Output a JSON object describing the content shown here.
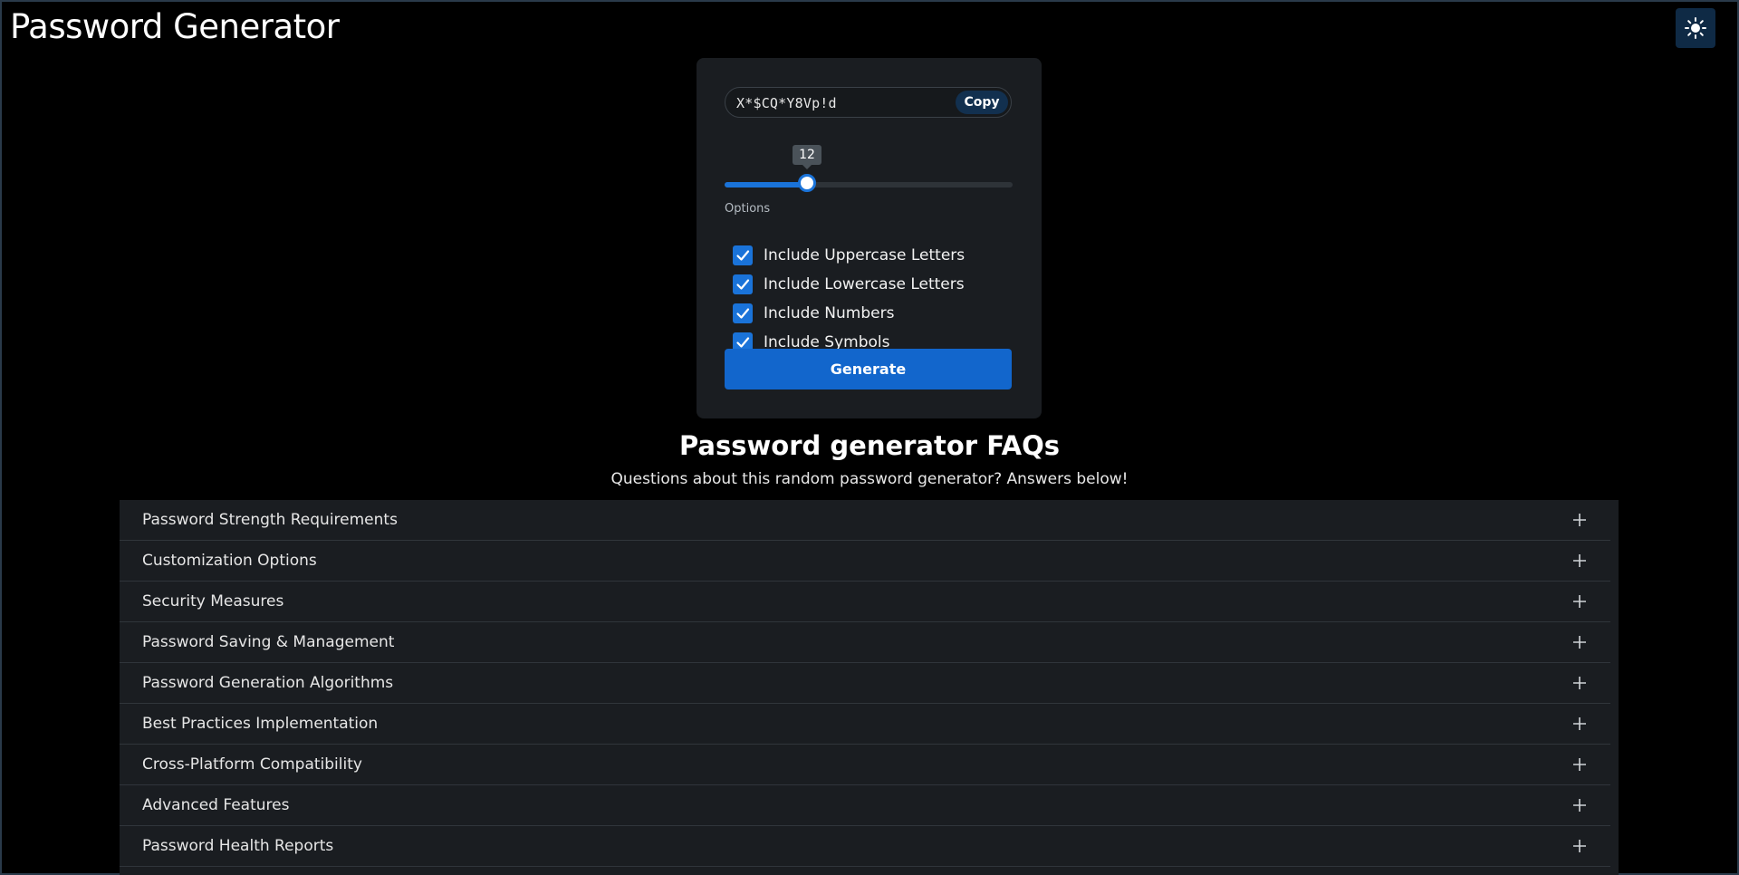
{
  "header": {
    "title": "Password Generator",
    "theme_toggle_icon": "sun-icon"
  },
  "generator": {
    "password": "X*$CQ*Y8Vp!d",
    "copy_label": "Copy",
    "length": 12,
    "length_display": "12",
    "length_min": 4,
    "length_max": 32,
    "options_label": "Options",
    "options": [
      {
        "label": "Include Uppercase Letters",
        "checked": true
      },
      {
        "label": "Include Lowercase Letters",
        "checked": true
      },
      {
        "label": "Include Numbers",
        "checked": true
      },
      {
        "label": "Include Symbols",
        "checked": true
      }
    ],
    "generate_label": "Generate"
  },
  "faq": {
    "title": "Password generator FAQs",
    "subtitle": "Questions about this random password generator? Answers below!",
    "items": [
      {
        "label": "Password Strength Requirements"
      },
      {
        "label": "Customization Options"
      },
      {
        "label": "Security Measures"
      },
      {
        "label": "Password Saving & Management"
      },
      {
        "label": "Password Generation Algorithms"
      },
      {
        "label": "Best Practices Implementation"
      },
      {
        "label": "Cross-Platform Compatibility"
      },
      {
        "label": "Advanced Features"
      },
      {
        "label": "Password Health Reports"
      }
    ]
  },
  "colors": {
    "background": "#000000",
    "card": "#1a1d21",
    "accent": "#1a73d9",
    "button": "#1266cc"
  }
}
